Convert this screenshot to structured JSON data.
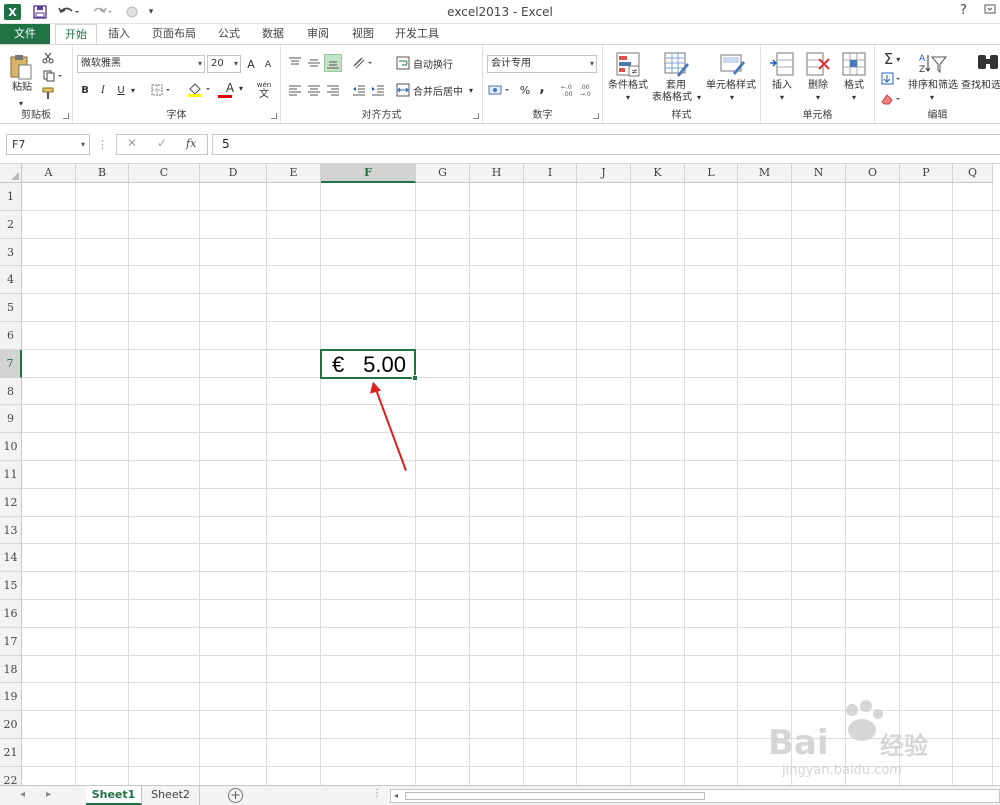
{
  "app": {
    "title": "excel2013 - Excel",
    "help": "?",
    "logo": "X"
  },
  "tabs": [
    {
      "label": "文件"
    },
    {
      "label": "开始"
    },
    {
      "label": "插入"
    },
    {
      "label": "页面布局"
    },
    {
      "label": "公式"
    },
    {
      "label": "数据"
    },
    {
      "label": "审阅"
    },
    {
      "label": "视图"
    },
    {
      "label": "开发工具"
    }
  ],
  "ribbon": {
    "clipboard": {
      "label": "剪贴板",
      "paste": "粘贴"
    },
    "font": {
      "label": "字体",
      "name": "微软雅黑",
      "size": "20",
      "bold": "B",
      "italic": "I",
      "underline": "U",
      "grow": "A",
      "shrink": "A",
      "fontcolor": "A",
      "wen": "wén",
      "wen_char": "文"
    },
    "alignment": {
      "label": "对齐方式",
      "wrap": "自动换行",
      "merge": "合并后居中"
    },
    "number": {
      "label": "数字",
      "format": "会计专用",
      "percent": "%",
      "comma": ","
    },
    "styles": {
      "label": "样式",
      "conditional": "条件格式",
      "table_line1": "套用",
      "table_line2": "表格格式",
      "cell_styles": "单元格样式"
    },
    "cells": {
      "label": "单元格",
      "insert": "插入",
      "delete": "删除",
      "format": "格式"
    },
    "editing": {
      "label": "编辑",
      "sigma": "Σ",
      "sort": "排序和筛选",
      "find": "查找和选"
    }
  },
  "formula_bar": {
    "name_box": "F7",
    "cancel": "✕",
    "enter": "✓",
    "fx": "fx",
    "value": "5"
  },
  "grid": {
    "columns": [
      "A",
      "B",
      "C",
      "D",
      "E",
      "F",
      "G",
      "H",
      "I",
      "J",
      "K",
      "L",
      "M",
      "N",
      "O",
      "P",
      "Q"
    ],
    "rows": [
      "1",
      "2",
      "3",
      "4",
      "5",
      "6",
      "7",
      "8",
      "9",
      "10",
      "11",
      "12",
      "13",
      "14",
      "15",
      "16",
      "17",
      "18",
      "19",
      "20",
      "21",
      "22"
    ],
    "selected_col": "F",
    "selected_row": "7",
    "active_cell": {
      "currency": "€",
      "number": "5.00"
    }
  },
  "sheets": {
    "tabs": [
      "Sheet1",
      "Sheet2"
    ],
    "active": "Sheet1",
    "add": "+"
  },
  "colors": {
    "accent": "#217346",
    "annotation": "#e02020"
  }
}
